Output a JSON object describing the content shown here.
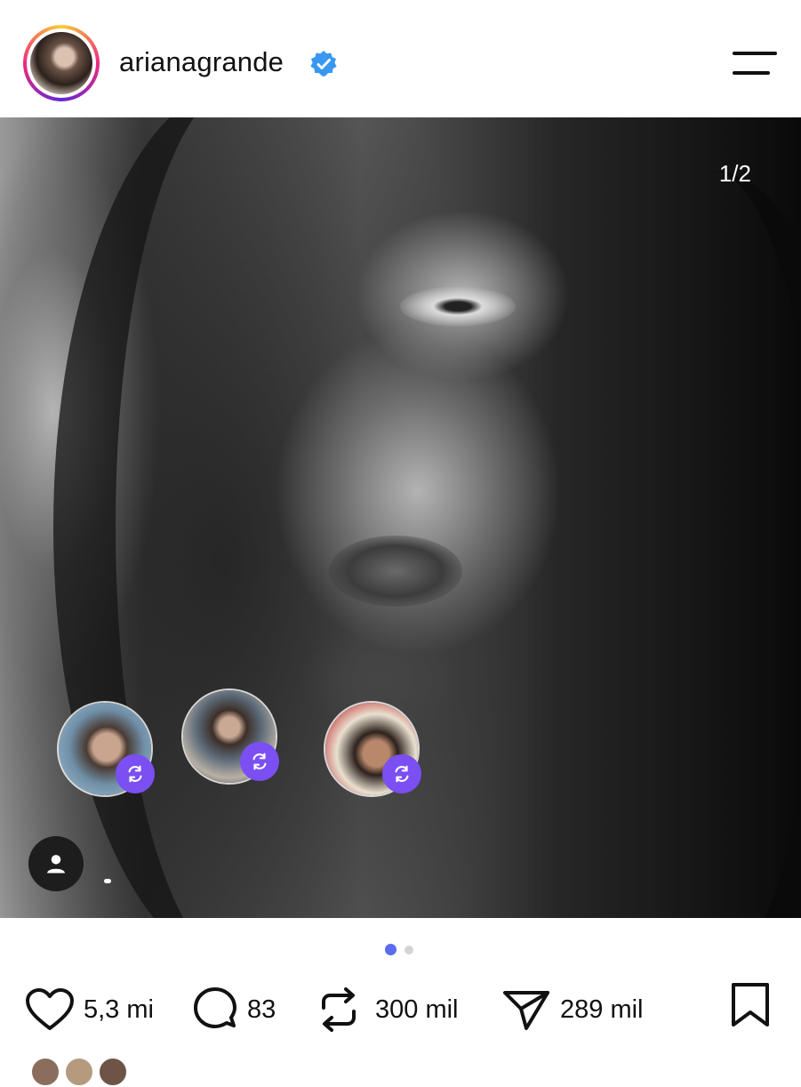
{
  "header": {
    "username": "arianagrande",
    "verified_color": "#3897f0",
    "avatar_ring_colors": [
      "#f9ce34",
      "#ee2a7b",
      "#6228d7"
    ]
  },
  "post": {
    "carousel_counter": "1/2",
    "carousel_total": 2,
    "carousel_active_index": 0,
    "repost_badge_color": "#7b4ff2"
  },
  "actions": {
    "likes": "5,3 mi",
    "comments": "83",
    "reposts": "300 mil",
    "shares": "289 mil"
  },
  "icons": {
    "menu": "hamburger-menu-icon",
    "like": "heart-icon",
    "comment": "comment-bubble-icon",
    "repost": "repost-arrows-icon",
    "share": "paper-plane-icon",
    "save": "bookmark-icon",
    "tag": "person-icon"
  },
  "accent_color": "#5b6cf0"
}
